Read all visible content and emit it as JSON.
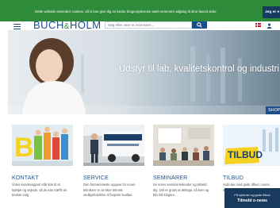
{
  "cookie_bar": {
    "text": "Dette website anvender cookies, så vi kan give dig en bedre brugeroplevelse samt nemmere adgang til dine favorit sider.",
    "button_label": "Jeg er e",
    "background": "#2e8b3a"
  },
  "header": {
    "logo_left": "BUCH",
    "logo_mid": "&",
    "logo_right": "HOLM",
    "search_placeholder": "Søg efter vare nr./varenavn...",
    "icons": [
      "menu-icon",
      "search-icon",
      "flag-icon",
      "user-icon"
    ],
    "brand_color": "#1b4f8c"
  },
  "hero": {
    "headline": "Udstyr til lab, kvalitetskontrol og industri",
    "button_label": "SHOP"
  },
  "cards": [
    {
      "title": "KONTAKT",
      "description": "Vores kundesupport står klar til at hjælpe og vejlede, så du kan træffe de bedste valg."
    },
    {
      "title": "SERVICE",
      "description": "Den formemmeste opgave for vores teknikere er at sikre teknisk vedligeholdelse af højeste kvalitet."
    },
    {
      "title": "SEMINARER",
      "description": "Se vores seminar-kalender og tilmeld dig. Det er gratis at deltage, så kom og bliv lidt klogere..."
    },
    {
      "title": "TILBUD",
      "description": "Hold øje med gode tilbud i vores webshop.",
      "image_label": "TILBUD"
    }
  ],
  "newsletter": {
    "line1": "Få nyheder og gode tilbud",
    "line2": "Tilmeld e-news"
  }
}
